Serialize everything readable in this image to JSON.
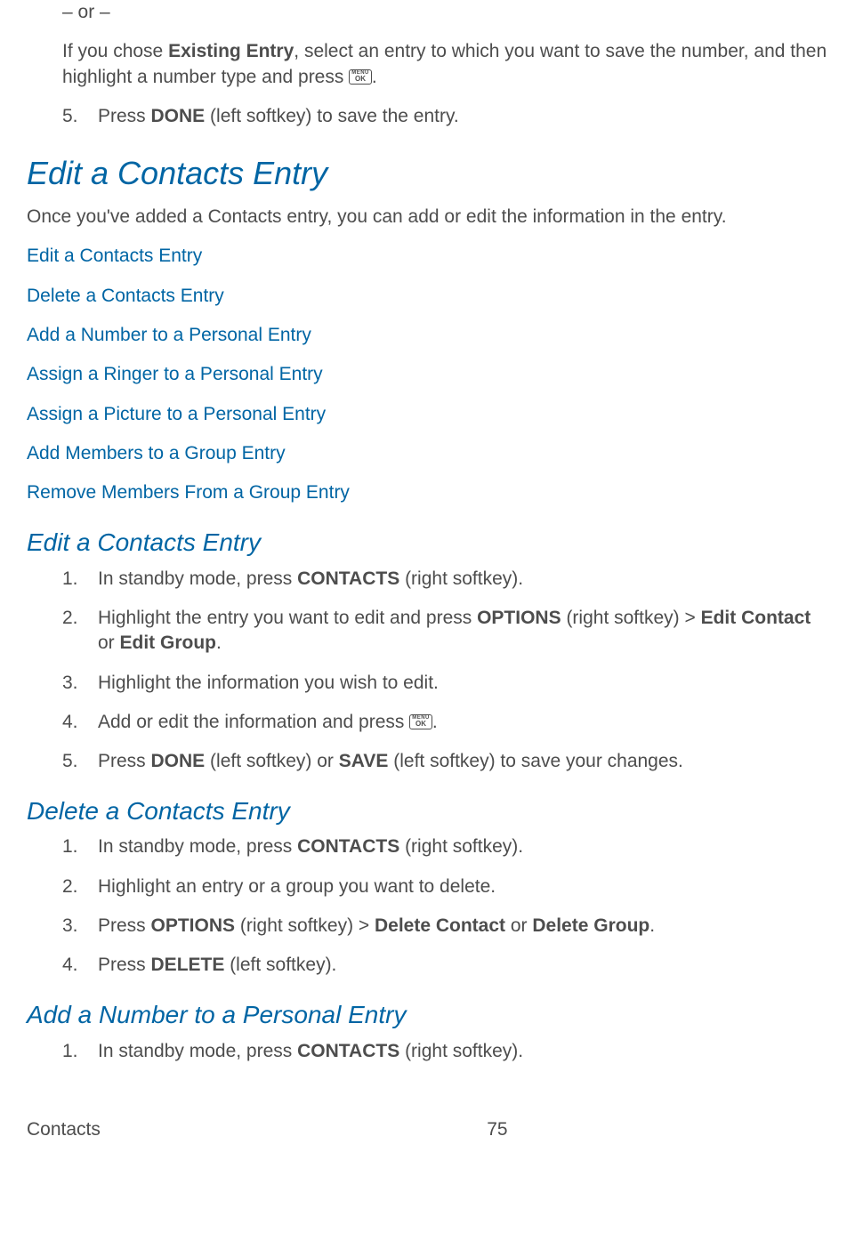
{
  "top": {
    "or_text": "– or –",
    "existing_entry_pre": "If you chose ",
    "existing_entry_bold": "Existing Entry",
    "existing_entry_post": ", select an entry to which you want to save the number, and then highlight a number type and press ",
    "existing_entry_end": ".",
    "step5_num": "5.",
    "step5_pre": "Press ",
    "step5_bold": "DONE",
    "step5_post": " (left softkey) to save the entry."
  },
  "h1_edit": "Edit a Contacts Entry",
  "h1_intro": "Once you've added a Contacts entry, you can add or edit the information in the entry.",
  "links": {
    "l1": "Edit a Contacts Entry",
    "l2": "Delete a Contacts Entry",
    "l3": "Add a Number to a Personal Entry",
    "l4": "Assign a Ringer to a Personal Entry",
    "l5": "Assign a Picture to a Personal Entry",
    "l6": "Add Members to a Group Entry",
    "l7": "Remove Members From a Group Entry"
  },
  "h2_edit": "Edit a Contacts Entry",
  "edit_steps": {
    "s1_num": "1.",
    "s1_pre": "In standby mode, press ",
    "s1_bold": "CONTACTS",
    "s1_post": " (right softkey).",
    "s2_num": "2.",
    "s2_pre": "Highlight the entry you want to edit and press ",
    "s2_bold1": "OPTIONS",
    "s2_mid1": " (right softkey) > ",
    "s2_bold2": "Edit Contact",
    "s2_mid2": " or ",
    "s2_bold3": "Edit Group",
    "s2_end": ".",
    "s3_num": "3.",
    "s3_text": "Highlight the information you wish to edit.",
    "s4_num": "4.",
    "s4_pre": "Add or edit the information and press ",
    "s4_end": ".",
    "s5_num": "5.",
    "s5_pre": "Press ",
    "s5_bold1": "DONE",
    "s5_mid1": " (left softkey) or ",
    "s5_bold2": "SAVE",
    "s5_post": " (left softkey) to save your changes."
  },
  "h2_delete": "Delete a Contacts Entry",
  "delete_steps": {
    "s1_num": "1.",
    "s1_pre": "In standby mode, press ",
    "s1_bold": "CONTACTS",
    "s1_post": " (right softkey).",
    "s2_num": "2.",
    "s2_text": "Highlight an entry or a group you want to delete.",
    "s3_num": "3.",
    "s3_pre": "Press ",
    "s3_bold1": "OPTIONS",
    "s3_mid1": " (right softkey) > ",
    "s3_bold2": "Delete Contact",
    "s3_mid2": " or ",
    "s3_bold3": "Delete Group",
    "s3_end": ".",
    "s4_num": "4.",
    "s4_pre": "Press ",
    "s4_bold": "DELETE",
    "s4_post": " (left softkey)."
  },
  "h2_add": "Add a Number to a Personal Entry",
  "add_steps": {
    "s1_num": "1.",
    "s1_pre": "In standby mode, press ",
    "s1_bold": "CONTACTS",
    "s1_post": " (right softkey)."
  },
  "footer": {
    "section": "Contacts",
    "page": "75"
  },
  "icon": {
    "top": "MENU",
    "bottom": "OK"
  }
}
